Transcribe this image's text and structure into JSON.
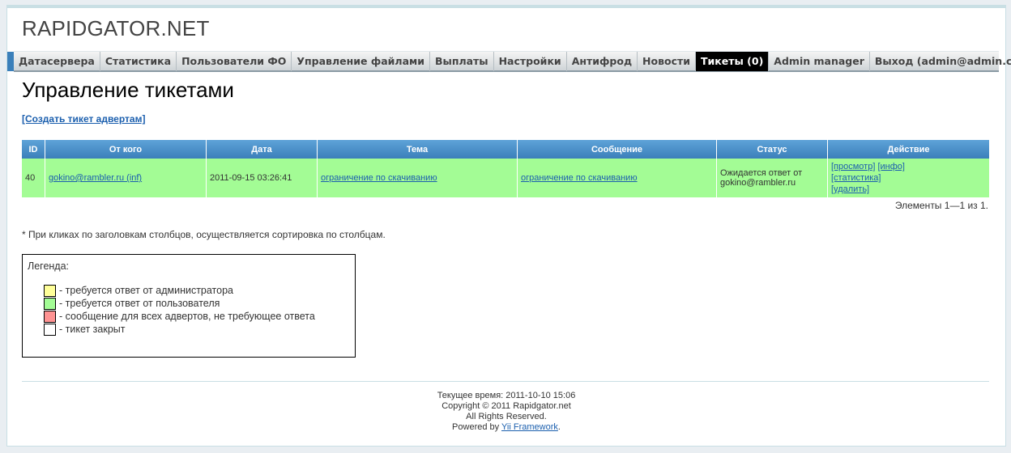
{
  "header": {
    "logo": "RAPIDGATOR.NET"
  },
  "menu": [
    {
      "label": "Датасервера"
    },
    {
      "label": "Статистика"
    },
    {
      "label": "Пользователи ФО"
    },
    {
      "label": "Управление файлами"
    },
    {
      "label": "Выплаты"
    },
    {
      "label": "Настройки"
    },
    {
      "label": "Антифрод"
    },
    {
      "label": "Новости"
    },
    {
      "label": "Тикеты (0)",
      "active": true
    },
    {
      "label": "Admin manager"
    },
    {
      "label": "Выход (admin@admin.com)"
    }
  ],
  "page": {
    "title": "Управление тикетами",
    "create_link": "[Создать тикет адвертам]"
  },
  "table": {
    "columns": [
      "ID",
      "От кого",
      "Дата",
      "Тема",
      "Сообщение",
      "Статус",
      "Действие"
    ],
    "rows": [
      {
        "id": "40",
        "from": "gokino@rambler.ru (inf)",
        "date": "2011-09-15 03:26:41",
        "subject": "ограничение по скачиванию",
        "message": "ограничение по скачиванию",
        "status": "Ожидается ответ от gokino@rambler.ru",
        "actions": {
          "view": "[просмотр]",
          "info": "[инфо]",
          "stats": "[статистика]",
          "delete": "[удалить]"
        }
      }
    ],
    "summary": "Элементы 1—1 из 1."
  },
  "note": "* При кликах по заголовкам столбцов, осуществляется сортировка по столбцам.",
  "legend": {
    "title": "Легенда:",
    "items": [
      {
        "color": "#ffff99",
        "label": "- требуется ответ от администратора"
      },
      {
        "color": "#a3fc95",
        "label": "- требуется ответ от пользователя"
      },
      {
        "color": "#ff9393",
        "label": "- сообщение для всех адвертов, не требующее ответа"
      },
      {
        "color": "#ffffff",
        "label": "- тикет закрыт"
      }
    ]
  },
  "footer": {
    "time": "Текущее время: 2011-10-10 15:06",
    "copyright": "Copyright © 2011 Rapidgator.net",
    "rights": "All Rights Reserved.",
    "powered_prefix": "Powered by ",
    "powered_link": "Yii Framework",
    "powered_suffix": "."
  }
}
